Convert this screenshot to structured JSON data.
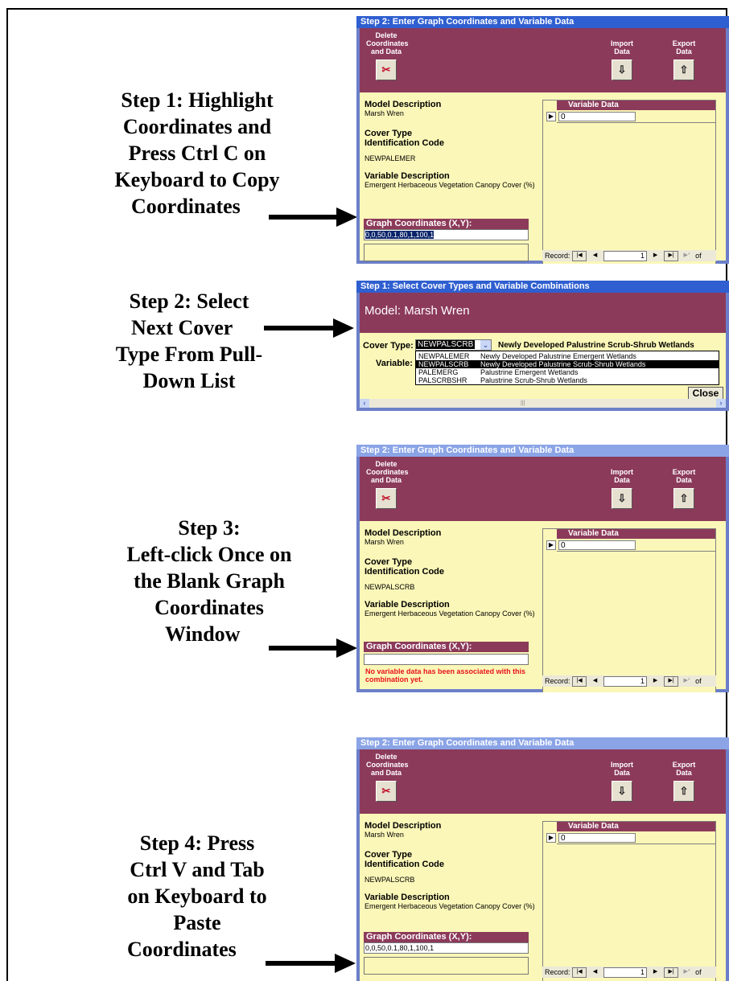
{
  "steps": [
    {
      "lines": [
        "Step 1:  Highlight",
        "Coordinates and",
        "Press Ctrl C on",
        "Keyboard to Copy",
        "Coordinates"
      ]
    },
    {
      "lines": [
        "Step 2:  Select",
        "Next Cover",
        "Type From Pull-",
        "Down List"
      ]
    },
    {
      "lines": [
        "Step 3:",
        "Left-click Once on",
        "the Blank Graph",
        "Coordinates",
        "Window"
      ]
    },
    {
      "lines": [
        "Step 4:  Press",
        "Ctrl V and Tab",
        "on Keyboard to",
        "Paste",
        "Coordinates"
      ]
    }
  ],
  "window_enter": {
    "title": "Step 2: Enter Graph Coordinates and Variable Data",
    "delete_label": [
      "Delete",
      "Coordinates",
      "and Data"
    ],
    "import_label": [
      "Import",
      "Data"
    ],
    "export_label": [
      "Export",
      "Data"
    ],
    "model_desc_label": "Model Description",
    "model_desc_value": "Marsh Wren",
    "cover_type_label": [
      "Cover Type",
      "Identification Code"
    ],
    "variable_desc_label": "Variable Description",
    "variable_desc_value": "Emergent Herbaceous Vegetation Canopy Cover  (%)",
    "variable_data_header": "Variable Data",
    "variable_data_value": "0",
    "graph_coords_label": "Graph Coordinates (X,Y):",
    "record_label": "Record:",
    "record_num": "1",
    "of_label": "of",
    "icons": [
      "delete-icon",
      "import-icon",
      "export-icon",
      "record-pointer-icon",
      "first-record-icon",
      "prev-record-icon",
      "next-record-icon",
      "last-record-icon",
      "new-record-icon"
    ]
  },
  "panel1": {
    "cover_code": "NEWPALEMER",
    "coords": "0,0,50,0.1,80,1,100,1",
    "message": ""
  },
  "panel3": {
    "cover_code": "NEWPALSCRB",
    "coords": "",
    "message": "No variable data has been associated with this combination yet."
  },
  "panel4": {
    "cover_code": "NEWPALSCRB",
    "coords": "0,0,50,0.1,80,1,100,1",
    "message": ""
  },
  "window_select": {
    "title": "Step 1: Select Cover Types and Variable Combinations",
    "model_text": "Model:  Marsh Wren",
    "cover_type_label": "Cover Type:",
    "variable_label": "Variable:",
    "selected_value": "NEWPALSCRB",
    "selected_desc": "Newly Developed Palustrine Scrub-Shrub Wetlands",
    "options": [
      {
        "code": "NEWPALEMER",
        "desc": "Newly Developed Palustrine Emergent Wetlands"
      },
      {
        "code": "NEWPALSCRB",
        "desc": "Newly Developed Palustrine Scrub-Shrub Wetlands"
      },
      {
        "code": "PALEMERG",
        "desc": "Palustrine Emergent Wetlands"
      },
      {
        "code": "PALSCRBSHR",
        "desc": "Palustrine Scrub-Shrub Wetlands"
      }
    ],
    "close_label": "Close"
  }
}
